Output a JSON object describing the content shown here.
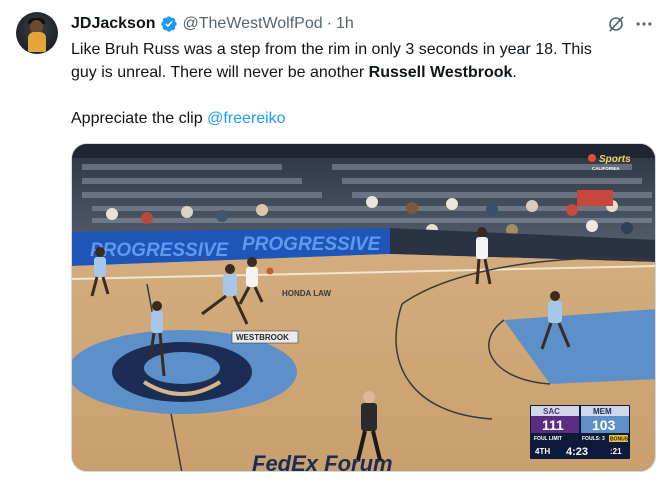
{
  "author": {
    "display_name": "JDJackson",
    "handle": "@TheWestWolfPod",
    "separator": "·",
    "time": "1h",
    "avatar_icon": "avatar-image",
    "verified_icon": "verified-badge-icon"
  },
  "tweet": {
    "line1": "Like Bruh Russ was a step from the rim in only 3 seconds in year 18. This",
    "line2_prefix": "guy is unreal.  There will never be another ",
    "line2_bold": "Russell Westbrook",
    "line2_suffix": ".",
    "line3_prefix": "Appreciate the clip ",
    "mention": "@freereiko"
  },
  "actions": {
    "grok_icon": "grok-icon",
    "more_icon": "more-dots-icon"
  },
  "media": {
    "banner_text1": "PROGRESSIVE",
    "banner_text2": "PROGRESSIVE",
    "baseline_text": "FedEx Forum",
    "sponsor_text": "HONDA LAW",
    "player_tag": "WESTBROOK",
    "broadcaster": "Sports",
    "broadcaster_sub": "CALIFORNIA",
    "scoreboard": {
      "team1": "SAC",
      "score1": "111",
      "team2": "MEM",
      "score2": "103",
      "team1_note": "FOUL LIMIT",
      "team2_note": "FOULS: 3",
      "team2_bonus": "BONUS",
      "quarter": "4TH",
      "clock": "4:23",
      "shot_clock": ":21"
    },
    "colors": {
      "court": "#d8b68a",
      "grizzlies_blue": "#5d8fc9",
      "navy": "#1c2d55",
      "sac_purple": "#5a2d81"
    }
  }
}
